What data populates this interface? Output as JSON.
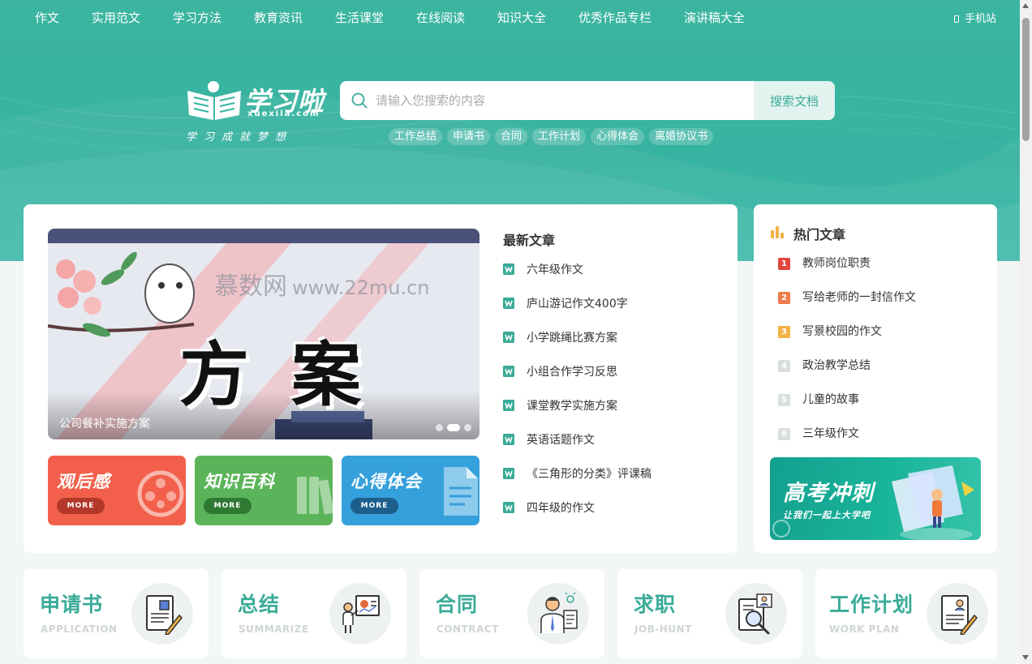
{
  "nav": {
    "items": [
      "作文",
      "实用范文",
      "学习方法",
      "教育资讯",
      "生活课堂",
      "在线阅读",
      "知识大全",
      "优秀作品专栏",
      "演讲稿大全"
    ],
    "mobile_label": "手机站"
  },
  "logo": {
    "name": "学习啦",
    "domain": "xuexila.com",
    "slogan": "学习成就梦想"
  },
  "search": {
    "placeholder": "请输入您搜索的内容",
    "button_label": "搜索文档"
  },
  "hot_tags": [
    "工作总结",
    "申请书",
    "合同",
    "工作计划",
    "心得体会",
    "离婚协议书"
  ],
  "banner": {
    "big_text_1": "方",
    "big_text_2": "案",
    "watermark": "慕数网",
    "watermark_url": "www.22mu.cn",
    "caption": "公司餐补实施方案"
  },
  "promos": [
    {
      "title": "观后感",
      "more": "MORE",
      "color": "#f2604b"
    },
    {
      "title": "知识百科",
      "more": "MORE",
      "color": "#5cb45a"
    },
    {
      "title": "心得体会",
      "more": "MORE",
      "color": "#34a0dc"
    }
  ],
  "latest": {
    "title": "最新文章",
    "items": [
      "六年级作文",
      "庐山游记作文400字",
      "小学跳绳比赛方案",
      "小组合作学习反思",
      "课堂教学实施方案",
      "英语话题作文",
      "《三角形的分类》评课稿",
      "四年级的作文"
    ]
  },
  "hot": {
    "title": "热门文章",
    "items": [
      {
        "rank": "1",
        "label": "教师岗位职责",
        "color": "#e2463b"
      },
      {
        "rank": "2",
        "label": "写给老师的一封信作文",
        "color": "#f07a4a"
      },
      {
        "rank": "3",
        "label": "写景校园的作文",
        "color": "#f2b245"
      },
      {
        "rank": "4",
        "label": "政治教学总结",
        "color": "#d9dede"
      },
      {
        "rank": "5",
        "label": "儿童的故事",
        "color": "#d9dede"
      },
      {
        "rank": "6",
        "label": "三年级作文",
        "color": "#d9dede"
      }
    ]
  },
  "gaokao": {
    "title": "高考冲刺",
    "subtitle": "让我们一起上大学吧"
  },
  "categories": [
    {
      "title": "申请书",
      "sub": "APPLICATION",
      "icon": "application-icon"
    },
    {
      "title": "总结",
      "sub": "SUMMARIZE",
      "icon": "summarize-icon"
    },
    {
      "title": "合同",
      "sub": "CONTRACT",
      "icon": "contract-icon"
    },
    {
      "title": "求职",
      "sub": "JOB-HUNT",
      "icon": "job-hunt-icon"
    },
    {
      "title": "工作计划",
      "sub": "WORK PLAN",
      "icon": "work-plan-icon"
    }
  ],
  "colors": {
    "brand": "#37b3a1",
    "accent_text": "#3aab98"
  }
}
